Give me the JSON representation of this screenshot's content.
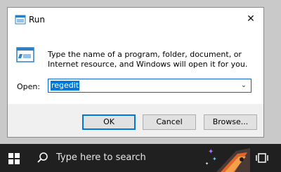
{
  "window": {
    "title": "Run",
    "close_glyph": "✕"
  },
  "content": {
    "description": "Type the name of a program, folder, document, or Internet resource, and Windows will open it for you.",
    "open_label": "Open:",
    "open_value": "regedit",
    "dropdown_glyph": "⌄"
  },
  "buttons": {
    "ok": "OK",
    "cancel": "Cancel",
    "browse": "Browse..."
  },
  "taskbar": {
    "search_placeholder": "Type here to search",
    "icons": [
      "windows-start-icon",
      "search-icon",
      "task-view-icon"
    ],
    "background": "#202020"
  },
  "colors": {
    "accent": "#0078d7",
    "selection": "#0078d7"
  }
}
